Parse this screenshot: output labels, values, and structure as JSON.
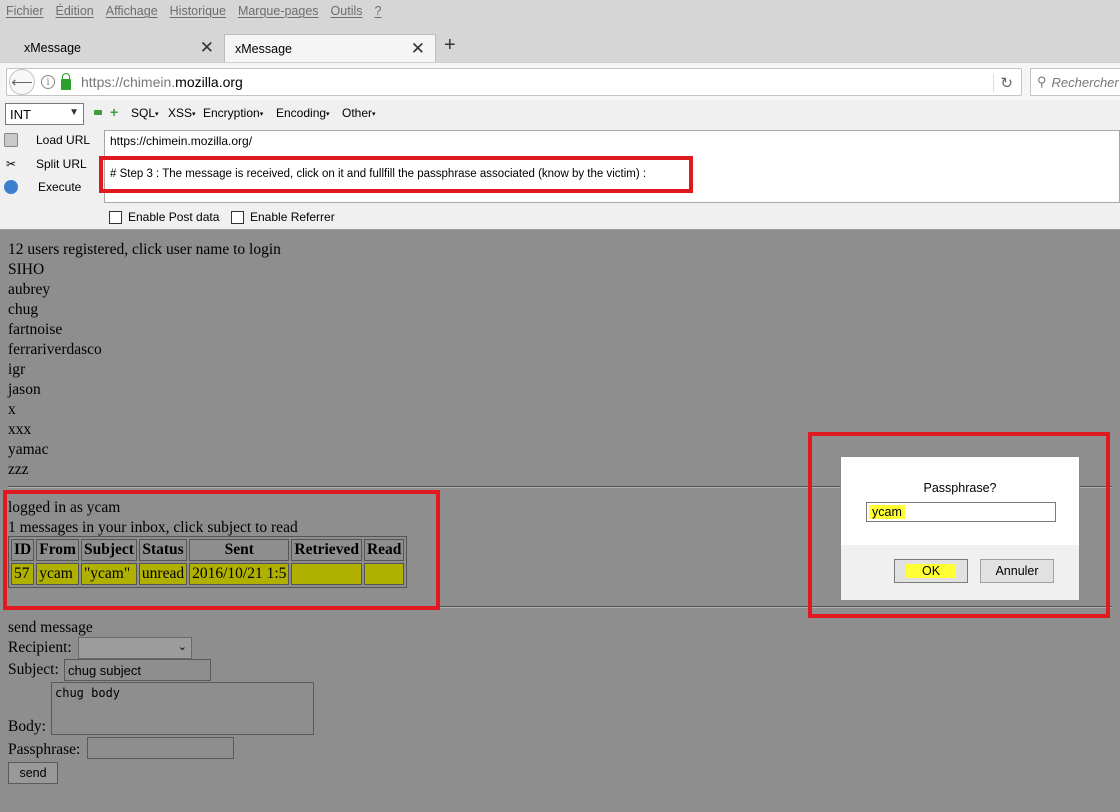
{
  "menu": [
    "Fichier",
    "Édition",
    "Affichage",
    "Historique",
    "Marque-pages",
    "Outils",
    "?"
  ],
  "tabs": [
    {
      "label": "xMessage"
    },
    {
      "label": "xMessage"
    }
  ],
  "nav": {
    "url_prefix": "https://chimein.",
    "url_domain": "mozilla.org",
    "search_placeholder": "Rechercher"
  },
  "hackbar": {
    "select_value": "INT",
    "menus": [
      "SQL",
      "XSS",
      "Encryption",
      "Encoding",
      "Other"
    ],
    "actions": [
      "Load URL",
      "Split URL",
      "Execute"
    ],
    "url_line": "https://chimein.mozilla.org/",
    "comment_line": "# Step 3 : The message is received, click on it and fullfill the passphrase associated (know by the victim) :",
    "checkboxes": [
      "Enable Post data",
      "Enable Referrer"
    ]
  },
  "page": {
    "users_header": "12 users registered, click user name to login",
    "users": [
      "SIHO",
      "aubrey",
      "chug",
      "fartnoise",
      "ferrariverdasco",
      "igr",
      "jason",
      "x",
      "xxx",
      "yamac",
      "zzz"
    ],
    "logged_in": "logged in as ycam",
    "inbox_info": "1 messages in your inbox, click subject to read",
    "inbox_headers": [
      "ID",
      "From",
      "Subject",
      "Status",
      "Sent",
      "Retrieved",
      "Read"
    ],
    "inbox_rows": [
      [
        "57",
        "ycam",
        "\"ycam\"",
        "unread",
        "2016/10/21 1:5",
        "",
        ""
      ]
    ],
    "send_header": "send message",
    "recipient_label": "Recipient:",
    "subject_label": "Subject:",
    "subject_value": "chug subject",
    "body_label": "Body:",
    "body_value": "chug body",
    "passphrase_label": "Passphrase:",
    "send_button": "send"
  },
  "dialog": {
    "question": "Passphrase?",
    "input_value": "ycam",
    "ok": "OK",
    "cancel": "Annuler"
  },
  "colors": {
    "annotation": "#e0181f",
    "highlight": "#b0b000"
  }
}
